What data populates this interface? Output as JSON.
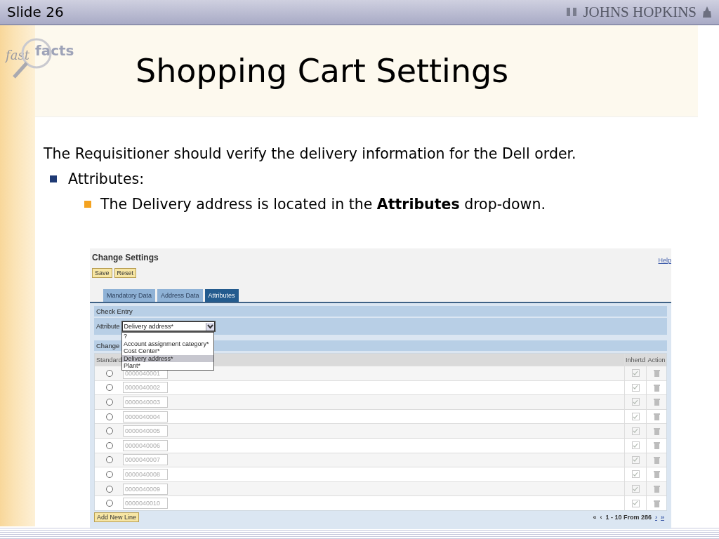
{
  "slide": {
    "number": "Slide 26",
    "brand": "JOHNS HOPKINS",
    "logo_words": [
      "fast",
      "facts"
    ],
    "title": "Shopping Cart Settings",
    "intro": "The Requisitioner should verify the delivery information for the Dell order.",
    "bullets": [
      {
        "text": "Attributes:",
        "children": [
          {
            "text": "The Delivery address is located in the **Attributes** drop-down."
          }
        ]
      }
    ]
  },
  "app": {
    "title": "Change Settings",
    "help": "Help",
    "buttons": [
      "Save",
      "Reset"
    ],
    "tabs": [
      {
        "label": "Mandatory Data",
        "selected": false
      },
      {
        "label": "Address Data",
        "selected": false
      },
      {
        "label": "Attributes",
        "selected": true
      }
    ],
    "check_entry": {
      "header": "Check Entry",
      "label": "Attribute",
      "value": "Delivery address*",
      "expanded": true,
      "options": [
        {
          "label": "?",
          "selected": false
        },
        {
          "label": "Account assignment category*",
          "selected": false
        },
        {
          "label": "Cost Center*",
          "selected": false
        },
        {
          "label": "Delivery address*",
          "selected": true
        },
        {
          "label": "Plant*",
          "selected": false
        }
      ]
    },
    "change_header": "Change",
    "table": {
      "columns": [
        "Standard",
        "Inhertd",
        "Action"
      ],
      "rows": [
        {
          "selected": false,
          "value": "0000040001",
          "inherited": true
        },
        {
          "selected": false,
          "value": "0000040002",
          "inherited": true
        },
        {
          "selected": false,
          "value": "0000040003",
          "inherited": true
        },
        {
          "selected": false,
          "value": "0000040004",
          "inherited": true
        },
        {
          "selected": false,
          "value": "0000040005",
          "inherited": true
        },
        {
          "selected": false,
          "value": "0000040006",
          "inherited": true
        },
        {
          "selected": false,
          "value": "0000040007",
          "inherited": true
        },
        {
          "selected": false,
          "value": "0000040008",
          "inherited": true
        },
        {
          "selected": false,
          "value": "0000040009",
          "inherited": true
        },
        {
          "selected": false,
          "value": "0000040010",
          "inherited": true
        }
      ]
    },
    "add_button": "Add New Line",
    "pager": {
      "first": "«",
      "prev": "‹",
      "range": "1 - 10 From 286",
      "next": "›",
      "last": "»"
    }
  }
}
